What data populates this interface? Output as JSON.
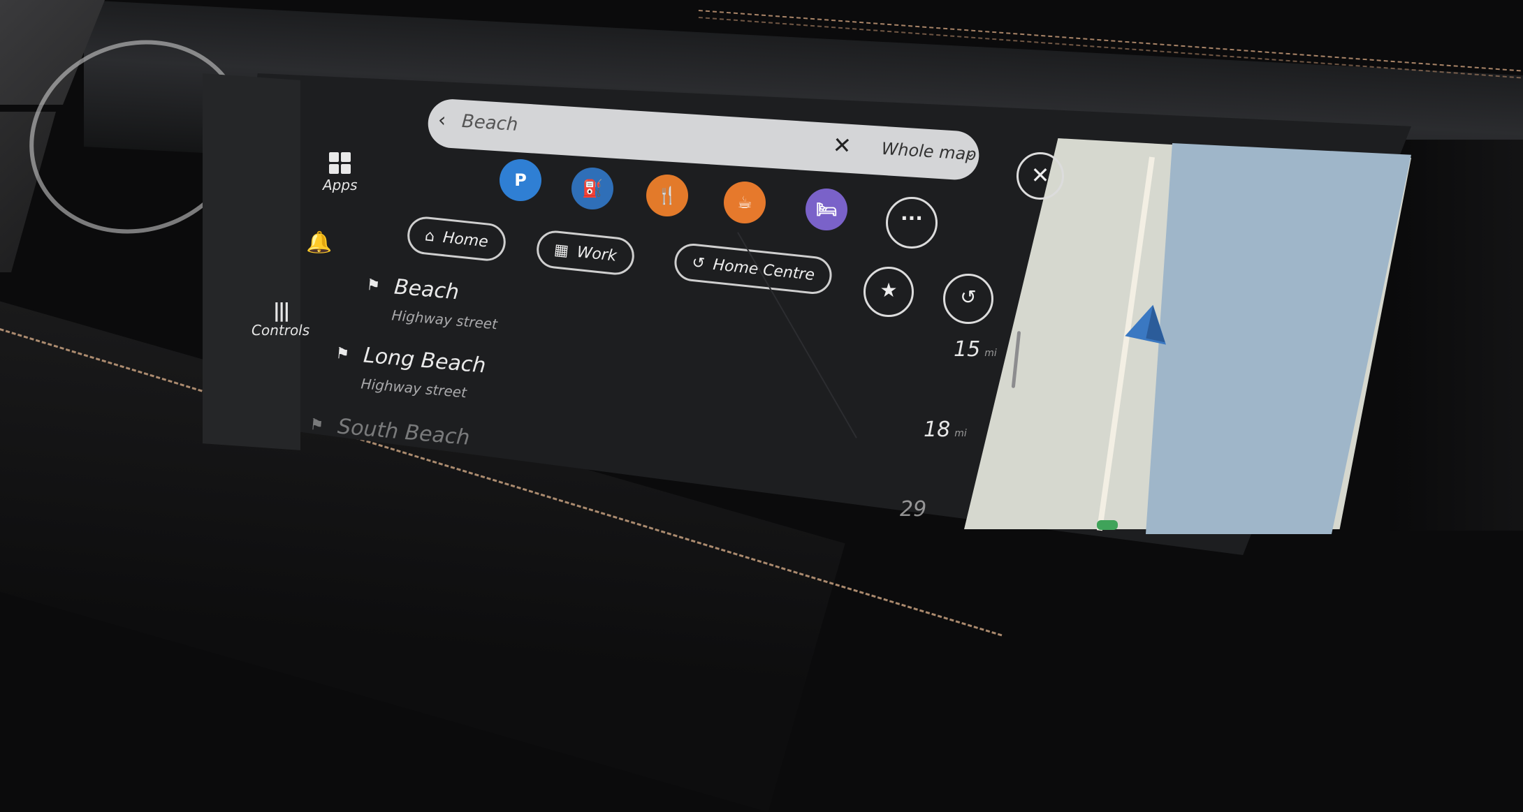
{
  "sidebar": {
    "apps_label": "Apps",
    "controls_label": "Controls"
  },
  "search": {
    "query": "Beach",
    "scope": "Whole map"
  },
  "categories": [
    {
      "name": "parking",
      "glyph": "P",
      "color": "#2f7fd4"
    },
    {
      "name": "fuel",
      "glyph": "⛽",
      "color": "#2f6fb8"
    },
    {
      "name": "restaurant",
      "glyph": "🍴",
      "color": "#e37a2a"
    },
    {
      "name": "cafe",
      "glyph": "☕",
      "color": "#e6792c"
    },
    {
      "name": "hotel",
      "glyph": "🛏",
      "color": "#7a62c9"
    }
  ],
  "shortcuts": {
    "home": "Home",
    "work": "Work",
    "recent": "Home Centre"
  },
  "results": [
    {
      "name": "Beach",
      "sub": "Highway street",
      "distance": "15"
    },
    {
      "name": "Long Beach",
      "sub": "Highway street",
      "distance": "18"
    },
    {
      "name": "South Beach",
      "sub": "",
      "distance": "29"
    }
  ],
  "colors": {
    "map_land": "#d6d8cf",
    "map_water": "#9fb6c9",
    "nav_arrow": "#3a78c2"
  }
}
